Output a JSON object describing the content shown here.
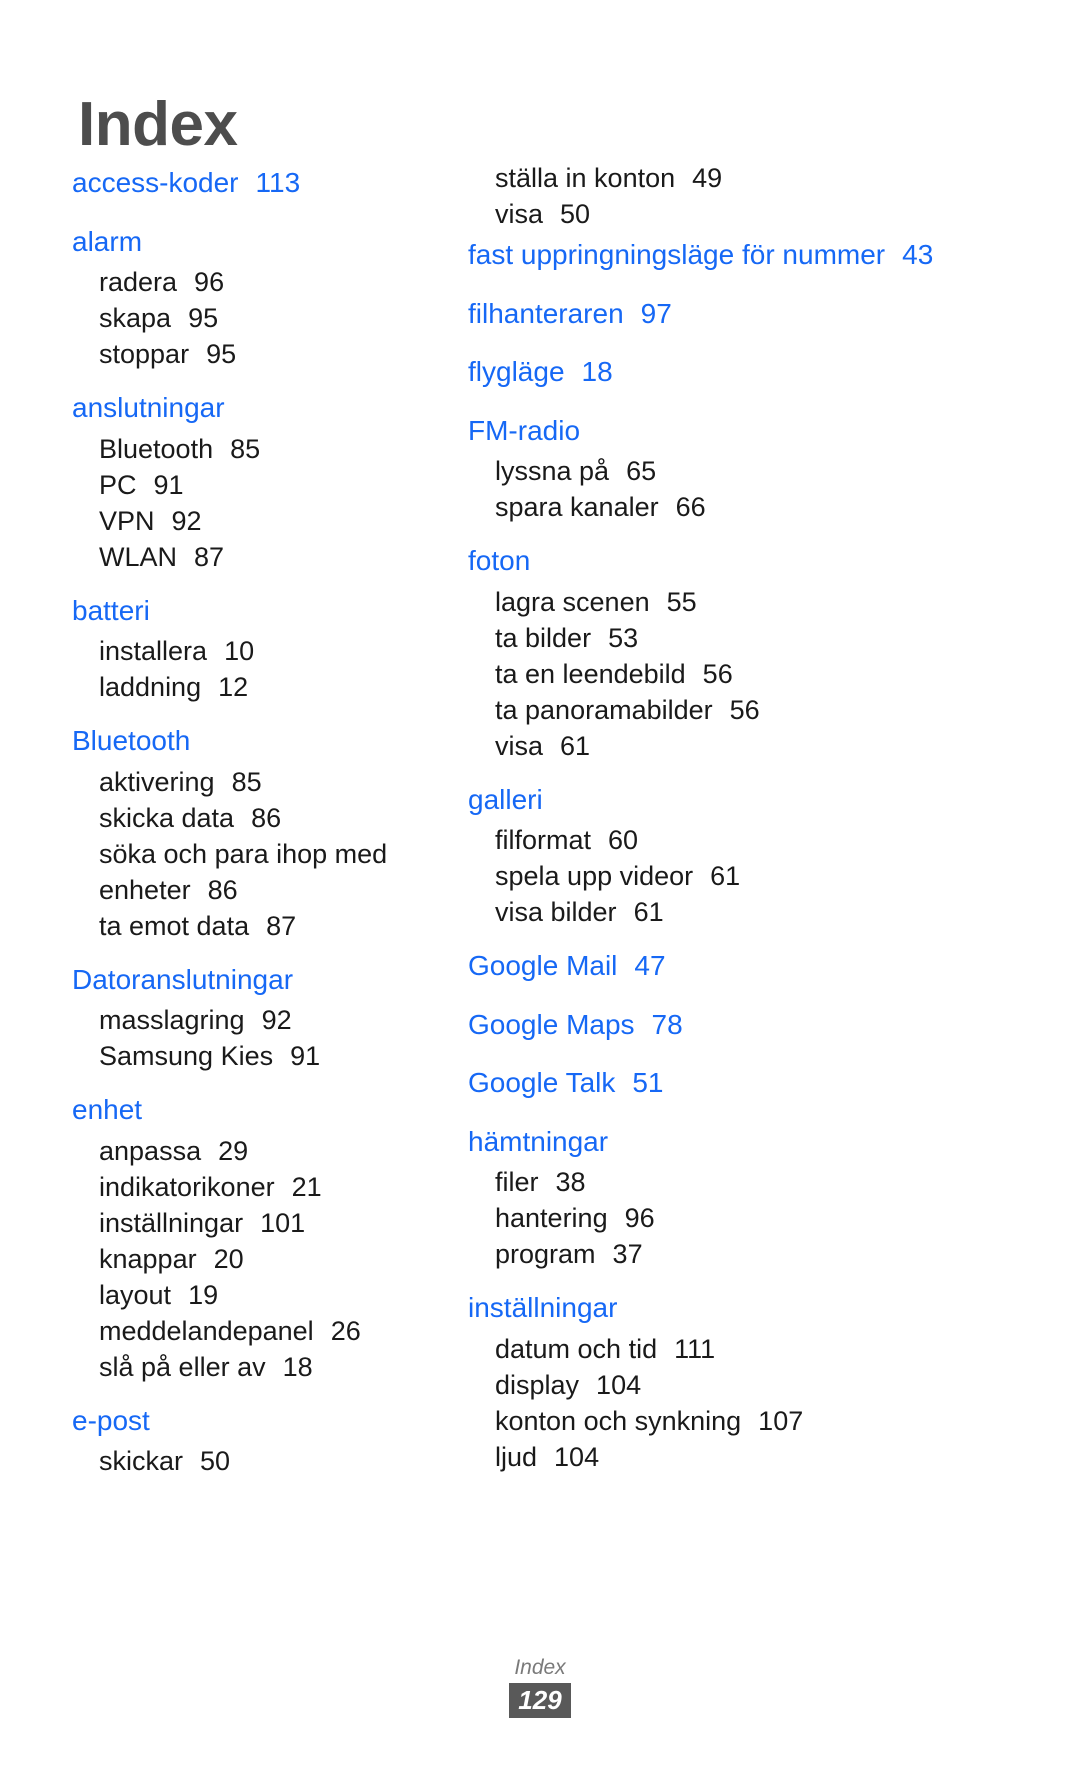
{
  "page": {
    "title": "Index",
    "footer_label": "Index",
    "footer_page_number": "129",
    "accent_color": "#1668f5",
    "title_color": "#4d4d4d",
    "body_color": "#1a1a1a",
    "footer_badge_bg": "#595959"
  },
  "columns": [
    {
      "name": "left-column",
      "groups": [
        {
          "heading": "access-koder",
          "heading_page": "113",
          "subentries": []
        },
        {
          "heading": "alarm",
          "heading_page": "",
          "subentries": [
            {
              "label": "radera",
              "page": "96"
            },
            {
              "label": "skapa",
              "page": "95"
            },
            {
              "label": "stoppar",
              "page": "95"
            }
          ]
        },
        {
          "heading": "anslutningar",
          "heading_page": "",
          "subentries": [
            {
              "label": "Bluetooth",
              "page": "85"
            },
            {
              "label": "PC",
              "page": "91"
            },
            {
              "label": "VPN",
              "page": "92"
            },
            {
              "label": "WLAN",
              "page": "87"
            }
          ]
        },
        {
          "heading": "batteri",
          "heading_page": "",
          "subentries": [
            {
              "label": "installera",
              "page": "10"
            },
            {
              "label": "laddning",
              "page": "12"
            }
          ]
        },
        {
          "heading": "Bluetooth",
          "heading_page": "",
          "subentries": [
            {
              "label": "aktivering",
              "page": "85"
            },
            {
              "label": "skicka data",
              "page": "86"
            },
            {
              "label": "söka och para ihop med enheter",
              "page": "86"
            },
            {
              "label": "ta emot data",
              "page": "87"
            }
          ]
        },
        {
          "heading": "Datoranslutningar",
          "heading_page": "",
          "subentries": [
            {
              "label": "masslagring",
              "page": "92"
            },
            {
              "label": "Samsung Kies",
              "page": "91"
            }
          ]
        },
        {
          "heading": "enhet",
          "heading_page": "",
          "subentries": [
            {
              "label": "anpassa",
              "page": "29"
            },
            {
              "label": "indikatorikoner",
              "page": "21"
            },
            {
              "label": "inställningar",
              "page": "101"
            },
            {
              "label": "knappar",
              "page": "20"
            },
            {
              "label": "layout",
              "page": "19"
            },
            {
              "label": "meddelandepanel",
              "page": "26"
            },
            {
              "label": "slå på eller av",
              "page": "18"
            }
          ]
        },
        {
          "heading": "e-post",
          "heading_page": "",
          "subentries": [
            {
              "label": "skickar",
              "page": "50"
            }
          ]
        }
      ]
    },
    {
      "name": "right-column",
      "groups": [
        {
          "heading": "",
          "heading_page": "",
          "subentries": [
            {
              "label": "ställa in konton",
              "page": "49"
            },
            {
              "label": "visa",
              "page": "50"
            }
          ]
        },
        {
          "heading": "fast uppringningsläge för nummer",
          "heading_page": "43",
          "subentries": []
        },
        {
          "heading": "filhanteraren",
          "heading_page": "97",
          "subentries": []
        },
        {
          "heading": "flygläge",
          "heading_page": "18",
          "subentries": []
        },
        {
          "heading": "FM-radio",
          "heading_page": "",
          "subentries": [
            {
              "label": "lyssna på",
              "page": "65"
            },
            {
              "label": "spara kanaler",
              "page": "66"
            }
          ]
        },
        {
          "heading": "foton",
          "heading_page": "",
          "subentries": [
            {
              "label": "lagra scenen",
              "page": "55"
            },
            {
              "label": "ta bilder",
              "page": "53"
            },
            {
              "label": "ta en leendebild",
              "page": "56"
            },
            {
              "label": "ta panoramabilder",
              "page": "56"
            },
            {
              "label": "visa",
              "page": "61"
            }
          ]
        },
        {
          "heading": "galleri",
          "heading_page": "",
          "subentries": [
            {
              "label": "filformat",
              "page": "60"
            },
            {
              "label": "spela upp videor",
              "page": "61"
            },
            {
              "label": "visa bilder",
              "page": "61"
            }
          ]
        },
        {
          "heading": "Google Mail",
          "heading_page": "47",
          "subentries": []
        },
        {
          "heading": "Google Maps",
          "heading_page": "78",
          "subentries": []
        },
        {
          "heading": "Google Talk",
          "heading_page": "51",
          "subentries": []
        },
        {
          "heading": "hämtningar",
          "heading_page": "",
          "subentries": [
            {
              "label": "filer",
              "page": "38"
            },
            {
              "label": "hantering",
              "page": "96"
            },
            {
              "label": "program",
              "page": "37"
            }
          ]
        },
        {
          "heading": "inställningar",
          "heading_page": "",
          "subentries": [
            {
              "label": "datum och tid",
              "page": "111"
            },
            {
              "label": "display",
              "page": "104"
            },
            {
              "label": "konton och synkning",
              "page": "107"
            },
            {
              "label": "ljud",
              "page": "104"
            }
          ]
        }
      ]
    }
  ]
}
